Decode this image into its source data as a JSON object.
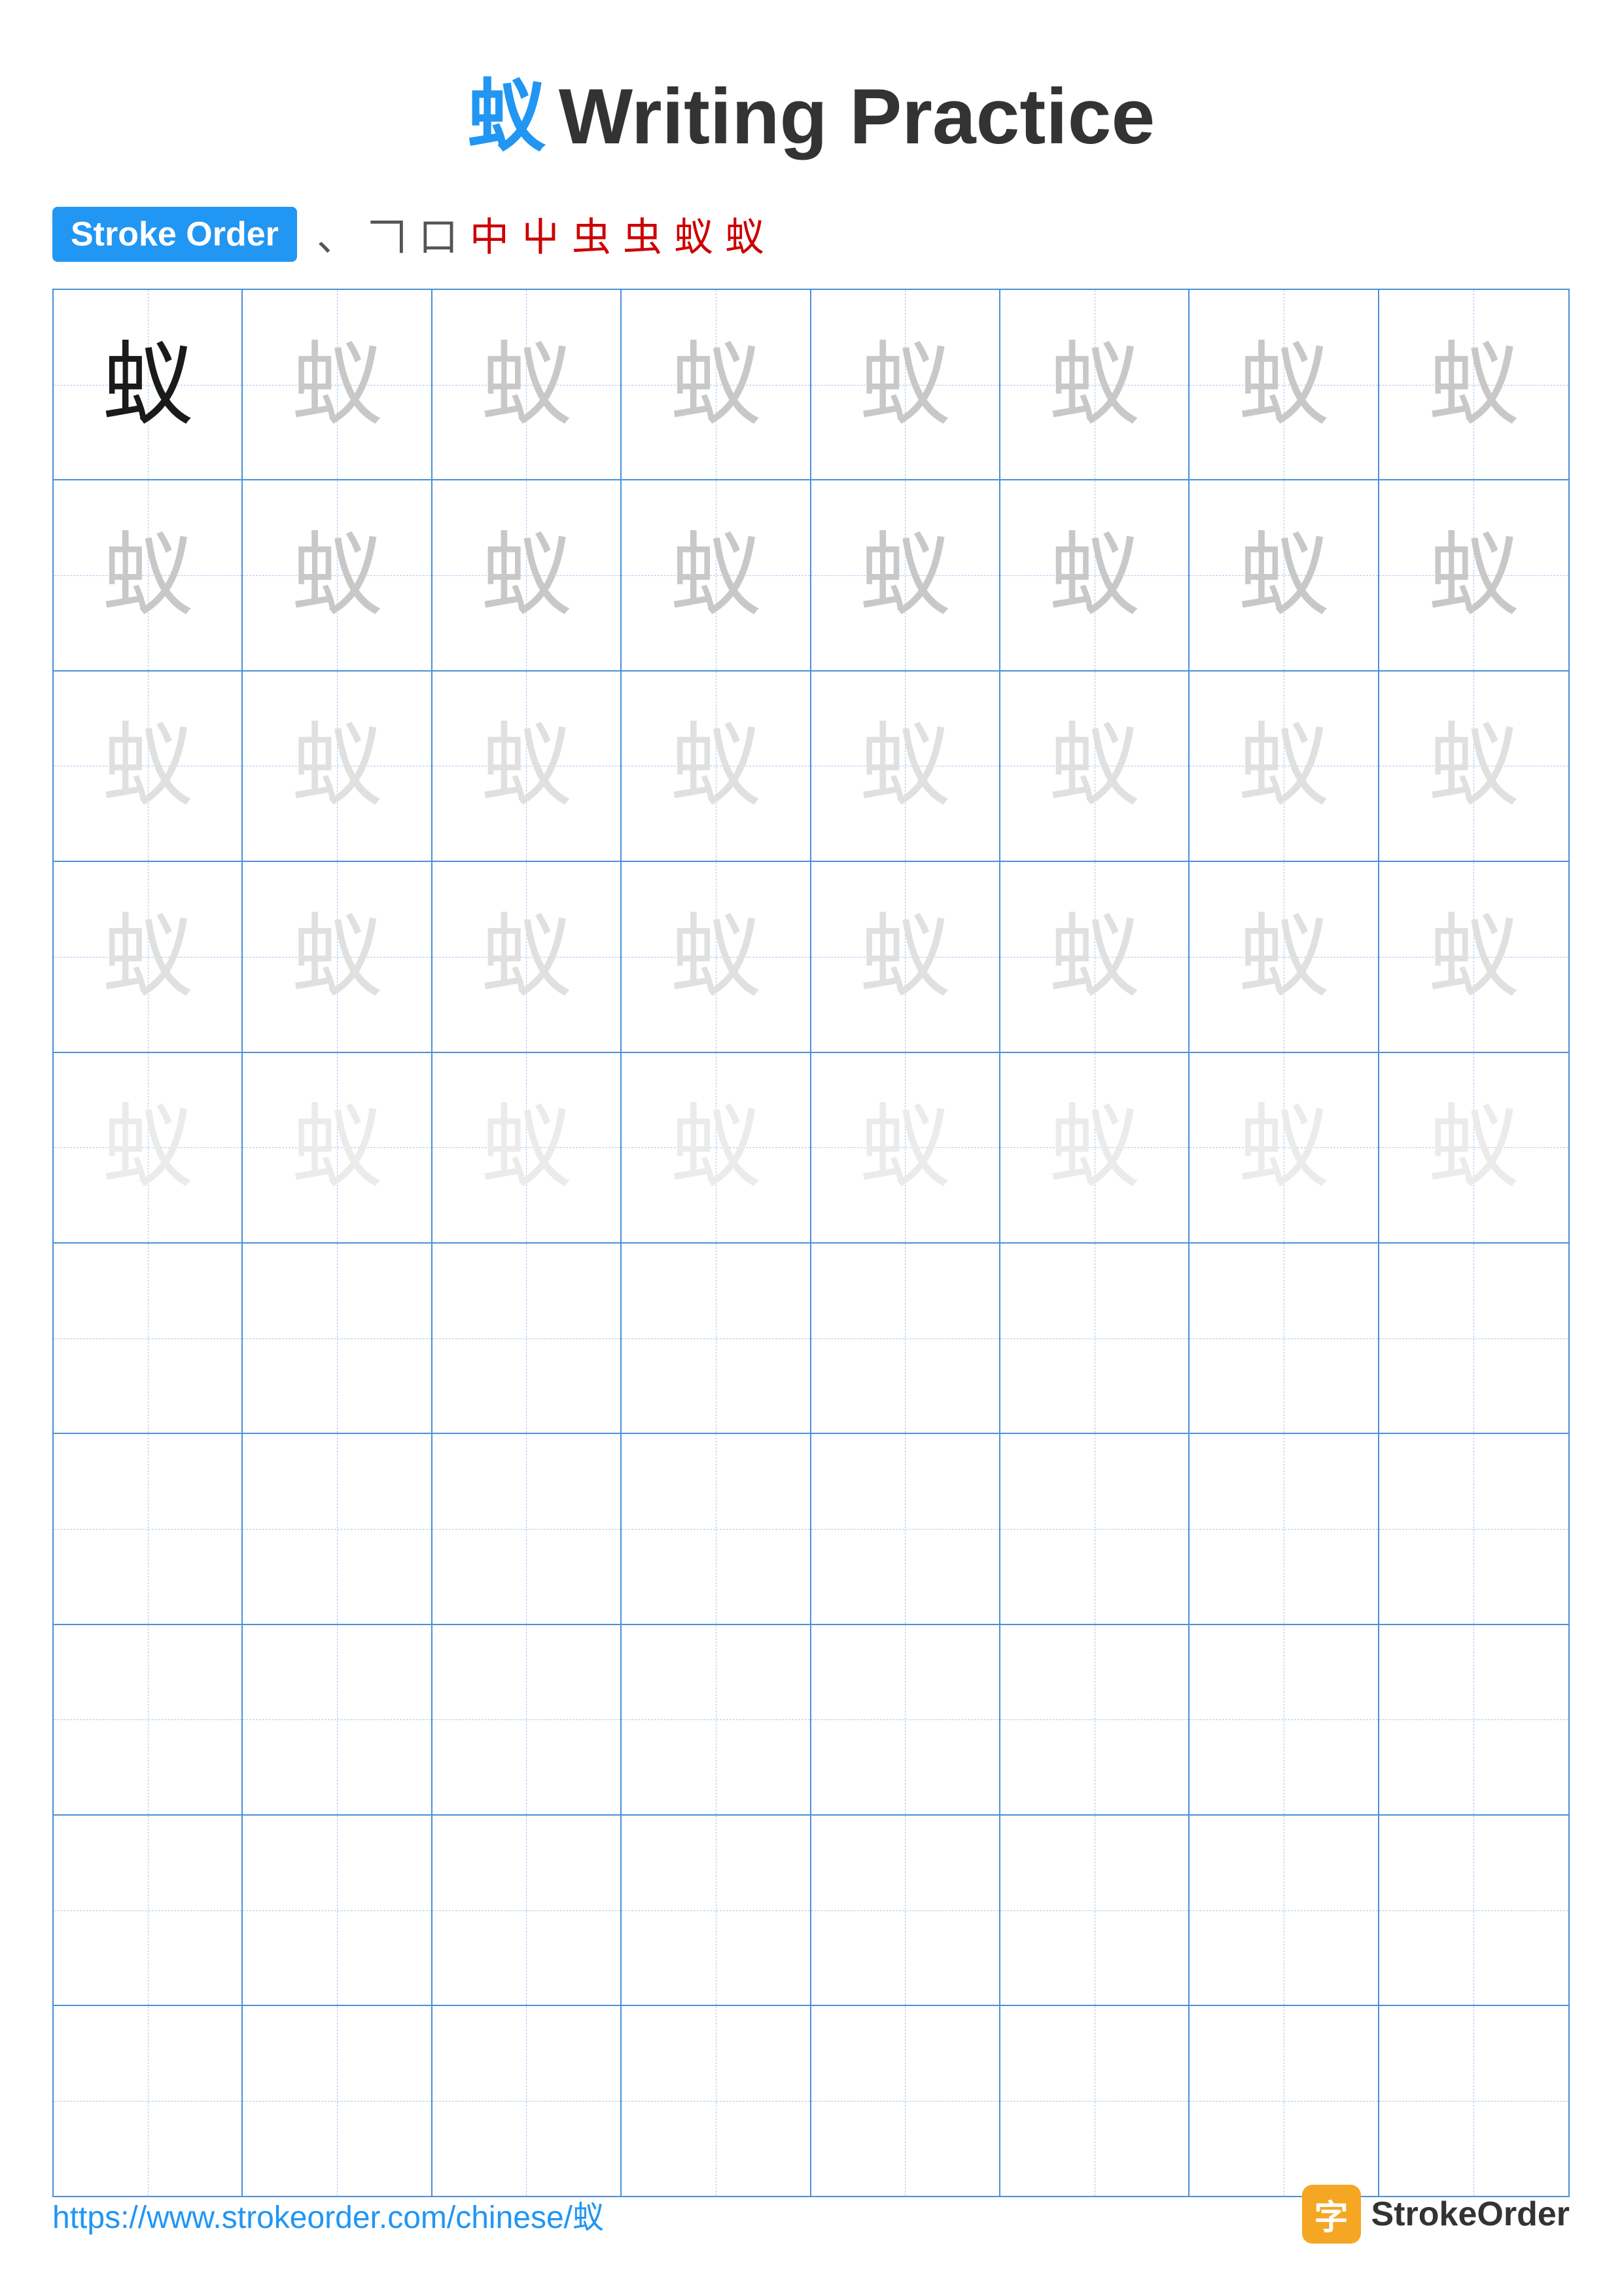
{
  "page": {
    "title": "Writing Practice",
    "character": "蚁",
    "title_color": "#2196F3"
  },
  "stroke_order": {
    "badge_label": "Stroke Order",
    "strokes": [
      "、",
      "𠃍",
      "口",
      "中",
      "屮",
      "虫",
      "虫",
      "蚁",
      "蚁"
    ]
  },
  "grid": {
    "rows": 10,
    "cols": 8,
    "character": "蚁"
  },
  "footer": {
    "url": "https://www.strokeorder.com/chinese/蚁",
    "logo_text": "StrokeOrder"
  }
}
